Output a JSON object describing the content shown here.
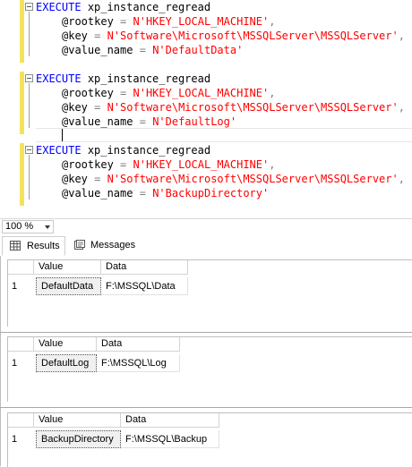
{
  "editor": {
    "blocks": [
      {
        "exec_keyword": "EXECUTE",
        "proc_name": "xp_instance_regread",
        "rootkey_param": "@rootkey",
        "rootkey_value": "N'HKEY_LOCAL_MACHINE'",
        "key_param": "@key",
        "key_value": "N'Software\\Microsoft\\MSSQLServer\\MSSQLServer'",
        "value_param": "@value_name",
        "value_value": "N'DefaultData'"
      },
      {
        "exec_keyword": "EXECUTE",
        "proc_name": "xp_instance_regread",
        "rootkey_param": "@rootkey",
        "rootkey_value": "N'HKEY_LOCAL_MACHINE'",
        "key_param": "@key",
        "key_value": "N'Software\\Microsoft\\MSSQLServer\\MSSQLServer'",
        "value_param": "@value_name",
        "value_value": "N'DefaultLog'"
      },
      {
        "exec_keyword": "EXECUTE",
        "proc_name": "xp_instance_regread",
        "rootkey_param": "@rootkey",
        "rootkey_value": "N'HKEY_LOCAL_MACHINE'",
        "key_param": "@key",
        "key_value": "N'Software\\Microsoft\\MSSQLServer\\MSSQLServer'",
        "value_param": "@value_name",
        "value_value": "N'BackupDirectory'"
      }
    ],
    "syntax_colors": {
      "keyword": "#0000ff",
      "string": "#ff0000",
      "operator": "#808080",
      "change_bar": "#f2e35a"
    }
  },
  "zoom": {
    "value": "100 %"
  },
  "results_tabs": [
    {
      "label": "Results",
      "icon": "grid-icon",
      "active": true
    },
    {
      "label": "Messages",
      "icon": "messages-icon",
      "active": false
    }
  ],
  "result_grids": [
    {
      "headers": [
        "Value",
        "Data"
      ],
      "rows": [
        {
          "num": "1",
          "value": "DefaultData",
          "data": "F:\\MSSQL\\Data"
        }
      ]
    },
    {
      "headers": [
        "Value",
        "Data"
      ],
      "rows": [
        {
          "num": "1",
          "value": "DefaultLog",
          "data": "F:\\MSSQL\\Log"
        }
      ]
    },
    {
      "headers": [
        "Value",
        "Data"
      ],
      "rows": [
        {
          "num": "1",
          "value": "BackupDirectory",
          "data": "F:\\MSSQL\\Backup"
        }
      ]
    }
  ]
}
